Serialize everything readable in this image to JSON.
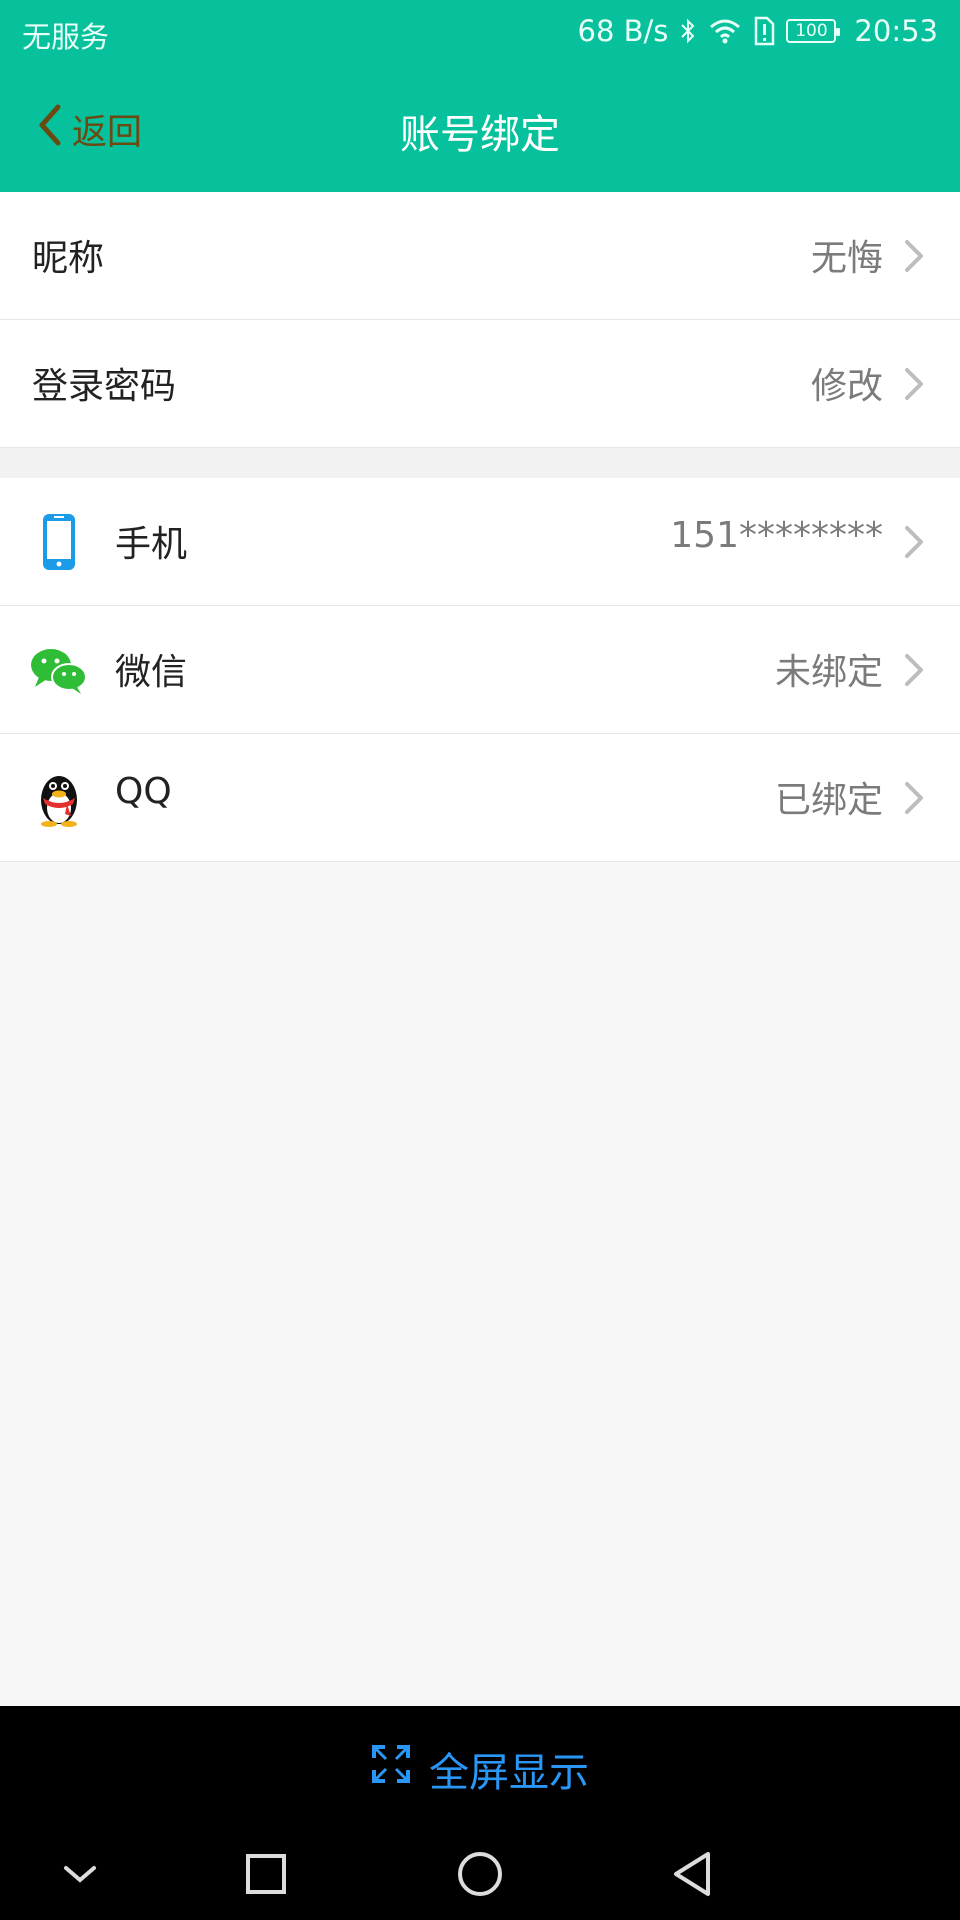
{
  "status_bar": {
    "carrier": "无服务",
    "speed": "68 B/s",
    "battery": "100",
    "time": "20:53"
  },
  "nav": {
    "back_label": "返回",
    "title": "账号绑定"
  },
  "profile_rows": [
    {
      "label": "昵称",
      "value": "无悔"
    },
    {
      "label": "登录密码",
      "value": "修改"
    }
  ],
  "binding_rows": [
    {
      "label": "手机",
      "value": "151********",
      "icon": "phone-icon"
    },
    {
      "label": "微信",
      "value": "未绑定",
      "icon": "wechat-icon"
    },
    {
      "label": "QQ",
      "value": "已绑定",
      "icon": "qq-icon"
    }
  ],
  "bottom": {
    "fullscreen_label": "全屏显示"
  },
  "colors": {
    "header": "#06c19b",
    "back": "#6b4a12",
    "fullscreen": "#2a97f7"
  }
}
